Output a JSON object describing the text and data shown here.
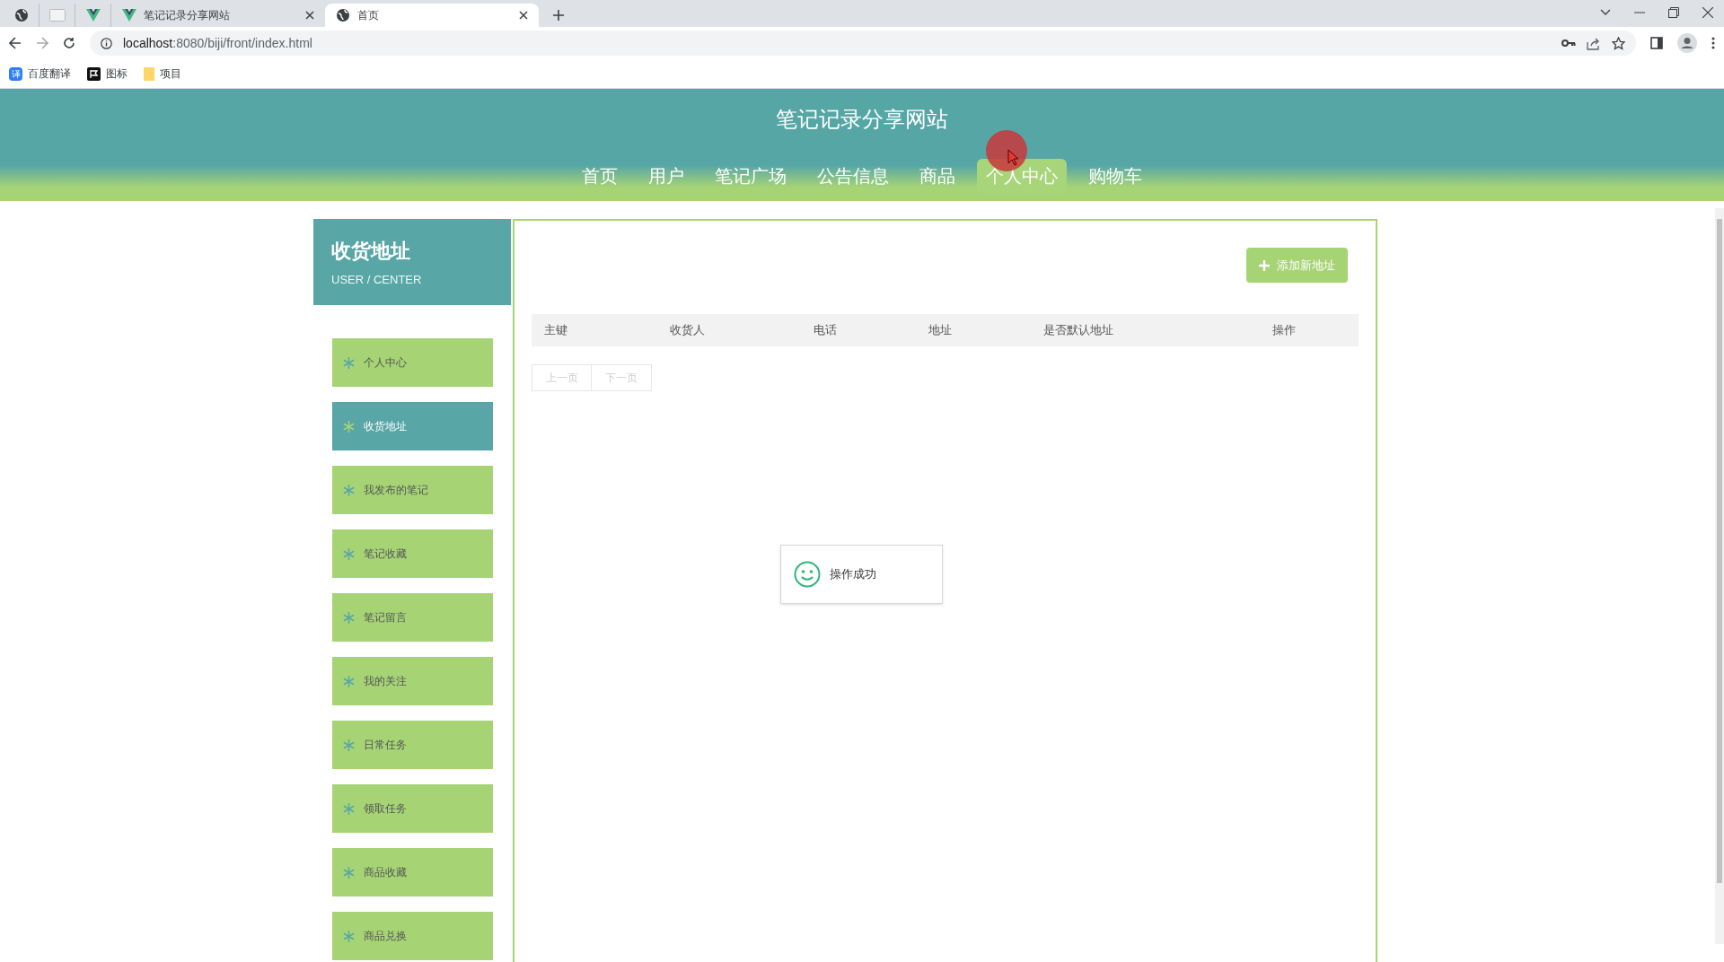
{
  "browser": {
    "tabs": [
      {
        "kind": "pinned-globe",
        "selected": false
      },
      {
        "kind": "pinned-blank",
        "selected": false
      },
      {
        "kind": "pinned-v",
        "selected": false
      },
      {
        "kind": "page-v",
        "title": "笔记记录分享网站",
        "selected": false
      },
      {
        "kind": "page-globe",
        "title": "首页",
        "selected": true
      }
    ],
    "url_host": "localhost",
    "url_rest": ":8080/biji/front/index.html",
    "bookmarks": [
      {
        "kind": "translate",
        "label": "百度翻译",
        "glyph": "译"
      },
      {
        "kind": "flag",
        "label": "图标"
      },
      {
        "kind": "folder",
        "label": "项目"
      }
    ]
  },
  "site_title": "笔记记录分享网站",
  "nav": [
    {
      "label": "首页",
      "selected": false
    },
    {
      "label": "用户",
      "selected": false
    },
    {
      "label": "笔记广场",
      "selected": false
    },
    {
      "label": "公告信息",
      "selected": false
    },
    {
      "label": "商品",
      "selected": false
    },
    {
      "label": "个人中心",
      "selected": true
    },
    {
      "label": "购物车",
      "selected": false
    }
  ],
  "sidebar": {
    "title": "收货地址",
    "subtitle": "USER / CENTER",
    "items": [
      {
        "label": "个人中心",
        "selected": false
      },
      {
        "label": "收货地址",
        "selected": true
      },
      {
        "label": "我发布的笔记",
        "selected": false
      },
      {
        "label": "笔记收藏",
        "selected": false
      },
      {
        "label": "笔记留言",
        "selected": false
      },
      {
        "label": "我的关注",
        "selected": false
      },
      {
        "label": "日常任务",
        "selected": false
      },
      {
        "label": "领取任务",
        "selected": false
      },
      {
        "label": "商品收藏",
        "selected": false
      },
      {
        "label": "商品兑换",
        "selected": false
      }
    ]
  },
  "add_button": "添加新地址",
  "table": {
    "columns": [
      "主键",
      "收货人",
      "电话",
      "地址",
      "是否默认地址",
      "操作"
    ]
  },
  "pagination": [
    {
      "label": "上一页",
      "disabled": true
    },
    {
      "label": "下一页",
      "disabled": true
    }
  ],
  "toast": "操作成功"
}
